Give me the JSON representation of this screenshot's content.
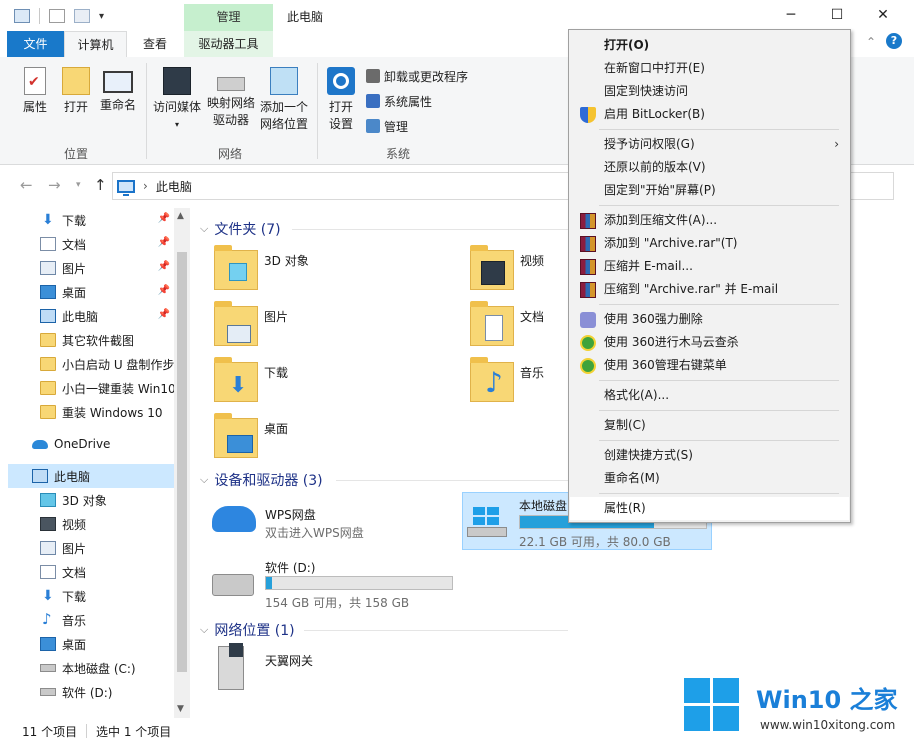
{
  "window": {
    "title": "此电脑",
    "context_tab_group": "管理",
    "minimize": "─",
    "maximize": "☐",
    "close": "✕"
  },
  "ribbon_tabs": {
    "file": "文件",
    "computer": "计算机",
    "view": "查看",
    "drive_tools": "驱动器工具"
  },
  "ribbon": {
    "properties": "属性",
    "open": "打开",
    "rename": "重命名",
    "location_group": "位置",
    "access_media": "访问媒体",
    "map_drive_1": "映射网络",
    "map_drive_2": "驱动器",
    "add_location_1": "添加一个",
    "add_location_2": "网络位置",
    "network_group": "网络",
    "open_settings_1": "打开",
    "open_settings_2": "设置",
    "uninstall": "卸载或更改程序",
    "system_properties": "系统属性",
    "manage": "管理",
    "system_group": "系统"
  },
  "address": {
    "path": "此电脑"
  },
  "nav": {
    "items": [
      {
        "label": "下载",
        "pinned": true
      },
      {
        "label": "文档",
        "pinned": true
      },
      {
        "label": "图片",
        "pinned": true
      },
      {
        "label": "桌面",
        "pinned": true
      },
      {
        "label": "此电脑",
        "pinned": true
      },
      {
        "label": "其它软件截图",
        "pinned": false
      },
      {
        "label": "小白启动 U 盘制作步",
        "pinned": false
      },
      {
        "label": "小白一键重装 Win10",
        "pinned": false
      },
      {
        "label": "重装 Windows 10",
        "pinned": false
      },
      {
        "label": "OneDrive",
        "pinned": false
      },
      {
        "label": "此电脑",
        "pinned": false
      },
      {
        "label": "3D 对象",
        "pinned": false
      },
      {
        "label": "视频",
        "pinned": false
      },
      {
        "label": "图片",
        "pinned": false
      },
      {
        "label": "文档",
        "pinned": false
      },
      {
        "label": "下载",
        "pinned": false
      },
      {
        "label": "音乐",
        "pinned": false
      },
      {
        "label": "桌面",
        "pinned": false
      },
      {
        "label": "本地磁盘 (C:)",
        "pinned": false
      },
      {
        "label": "软件 (D:)",
        "pinned": false
      }
    ]
  },
  "content": {
    "folders_header": "文件夹 (7)",
    "folders": [
      "3D 对象",
      "视频",
      "图片",
      "文档",
      "下载",
      "音乐",
      "桌面"
    ],
    "devices_header": "设备和驱动器 (3)",
    "wps_name": "WPS网盘",
    "wps_sub": "双击进入WPS网盘",
    "drive_c_name": "本地磁盘",
    "drive_c_free": "22.1 GB 可用，共 80.0 GB",
    "drive_c_used_fraction": 0.72,
    "drive_d_name": "软件 (D:)",
    "drive_d_free": "154 GB 可用，共 158 GB",
    "drive_d_used_fraction": 0.03,
    "network_header": "网络位置 (1)",
    "network_item": "天翼网关"
  },
  "status": {
    "items": "11 个项目",
    "selected": "选中 1 个项目"
  },
  "context_menu": {
    "items": [
      {
        "label": "打开(O)",
        "bold": true,
        "icon": ""
      },
      {
        "label": "在新窗口中打开(E)",
        "icon": ""
      },
      {
        "label": "固定到快速访问",
        "icon": ""
      },
      {
        "label": "启用 BitLocker(B)",
        "icon": "shield-icon"
      },
      {
        "label": "授予访问权限(G)",
        "icon": "",
        "submenu": true
      },
      {
        "label": "还原以前的版本(V)",
        "icon": ""
      },
      {
        "label": "固定到\"开始\"屏幕(P)",
        "icon": ""
      },
      {
        "label": "添加到压缩文件(A)...",
        "icon": "winrar-icon"
      },
      {
        "label": "添加到 \"Archive.rar\"(T)",
        "icon": "winrar-icon"
      },
      {
        "label": "压缩并 E-mail...",
        "icon": "winrar-icon"
      },
      {
        "label": "压缩到 \"Archive.rar\" 并 E-mail",
        "icon": "winrar-icon"
      },
      {
        "label": "使用 360强力删除",
        "icon": "360-delete-icon"
      },
      {
        "label": "使用 360进行木马云查杀",
        "icon": "360-icon"
      },
      {
        "label": "使用 360管理右键菜单",
        "icon": "360-icon"
      },
      {
        "label": "格式化(A)...",
        "icon": ""
      },
      {
        "label": "复制(C)",
        "icon": ""
      },
      {
        "label": "创建快捷方式(S)",
        "icon": ""
      },
      {
        "label": "重命名(M)",
        "icon": ""
      },
      {
        "label": "属性(R)",
        "icon": "",
        "hover": true
      }
    ]
  },
  "watermark": {
    "title": "Win10 之家",
    "url": "www.win10xitong.com"
  },
  "colors": {
    "accent": "#1979ca",
    "selection": "#cce8ff",
    "drive_bar": "#26a0da",
    "header_text": "#1e3287"
  }
}
